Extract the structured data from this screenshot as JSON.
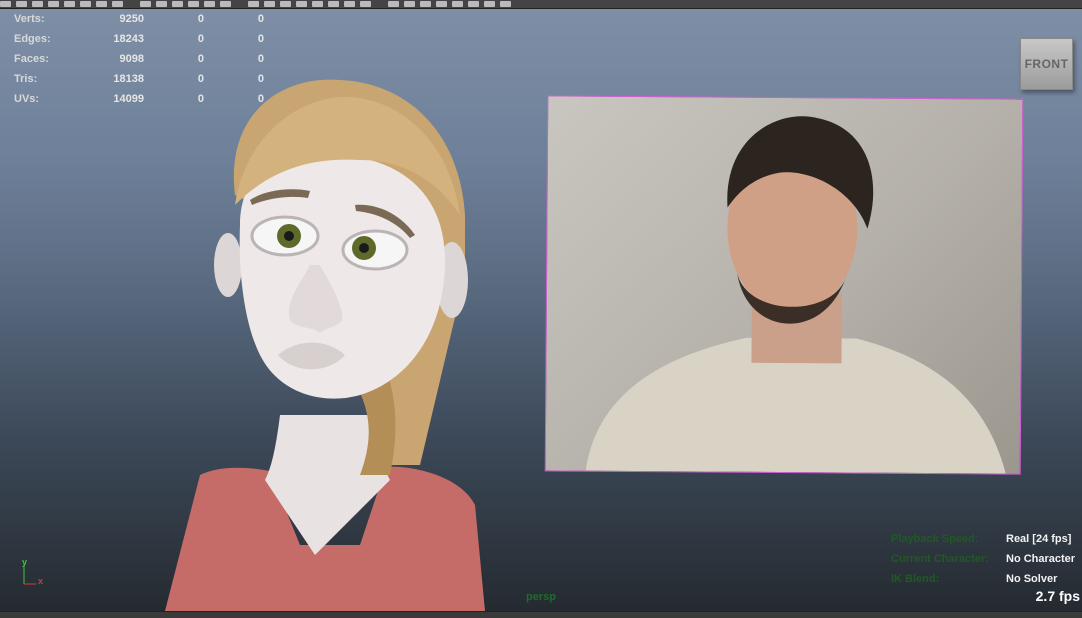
{
  "hud": {
    "rows": [
      {
        "label": "Verts:",
        "value": "9250",
        "c2": "0",
        "c3": "0"
      },
      {
        "label": "Edges:",
        "value": "18243",
        "c2": "0",
        "c3": "0"
      },
      {
        "label": "Faces:",
        "value": "9098",
        "c2": "0",
        "c3": "0"
      },
      {
        "label": "Tris:",
        "value": "18138",
        "c2": "0",
        "c3": "0"
      },
      {
        "label": "UVs:",
        "value": "14099",
        "c2": "0",
        "c3": "0"
      }
    ]
  },
  "viewcube": {
    "label": "FRONT"
  },
  "axis": {
    "y": "y",
    "x": "x"
  },
  "camera": {
    "name": "persp"
  },
  "status": {
    "playback_label": "Playback Speed:",
    "playback_value": "Real [24 fps]",
    "character_label": "Current Character:",
    "character_value": "No Character",
    "ik_label": "IK Blend:",
    "ik_value": "No Solver"
  },
  "fps": "2.7 fps",
  "icons": [
    "toolbar-icons",
    "viewcube-icon",
    "axis-gizmo-icon"
  ]
}
